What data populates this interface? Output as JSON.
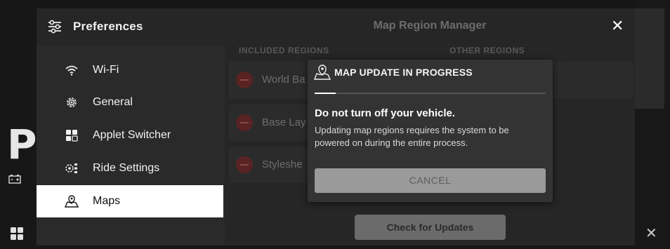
{
  "background": {
    "letter": "P"
  },
  "preferences": {
    "title": "Preferences",
    "items": [
      {
        "label": "Wi-Fi",
        "icon": "wifi-icon"
      },
      {
        "label": "General",
        "icon": "gear-icon"
      },
      {
        "label": "Applet Switcher",
        "icon": "grid-icon"
      },
      {
        "label": "Ride Settings",
        "icon": "ride-settings-icon"
      },
      {
        "label": "Maps",
        "icon": "map-icon",
        "active": true
      }
    ]
  },
  "map_manager": {
    "title": "Map Region Manager",
    "included_header": "INCLUDED REGIONS",
    "other_header": "OTHER REGIONS",
    "included_regions": [
      "World Ba",
      "Base Lay",
      "Styleshe"
    ],
    "other_regions_visible": "n",
    "check_button": "Check for Updates"
  },
  "modal": {
    "title": "MAP UPDATE IN PROGRESS",
    "progress": 0.09,
    "heading": "Do not turn off your vehicle.",
    "body": "Updating map regions requires the system to be powered on during the entire process.",
    "cancel_label": "CANCEL"
  },
  "colors": {
    "accent_active_bg": "#ffffff",
    "remove_button": "#5a2323",
    "modal_bg": "#333333"
  }
}
